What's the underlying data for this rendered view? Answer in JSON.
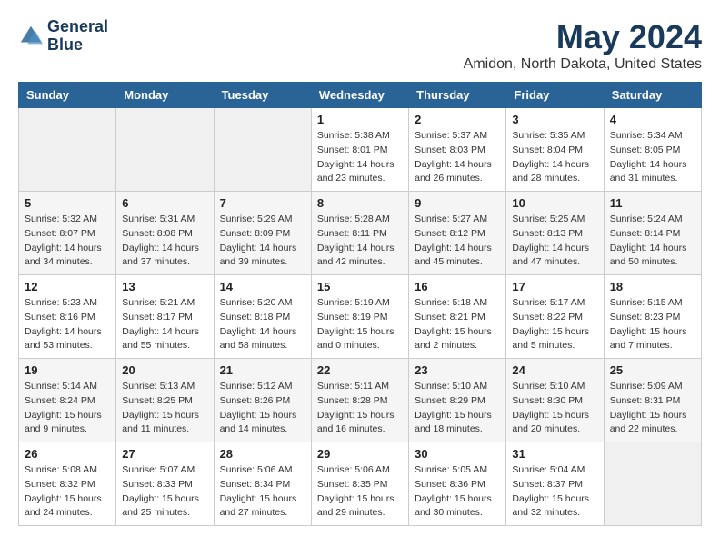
{
  "header": {
    "logo_line1": "General",
    "logo_line2": "Blue",
    "month_title": "May 2024",
    "location": "Amidon, North Dakota, United States"
  },
  "weekdays": [
    "Sunday",
    "Monday",
    "Tuesday",
    "Wednesday",
    "Thursday",
    "Friday",
    "Saturday"
  ],
  "weeks": [
    [
      {
        "day": "",
        "info": ""
      },
      {
        "day": "",
        "info": ""
      },
      {
        "day": "",
        "info": ""
      },
      {
        "day": "1",
        "info": "Sunrise: 5:38 AM\nSunset: 8:01 PM\nDaylight: 14 hours\nand 23 minutes."
      },
      {
        "day": "2",
        "info": "Sunrise: 5:37 AM\nSunset: 8:03 PM\nDaylight: 14 hours\nand 26 minutes."
      },
      {
        "day": "3",
        "info": "Sunrise: 5:35 AM\nSunset: 8:04 PM\nDaylight: 14 hours\nand 28 minutes."
      },
      {
        "day": "4",
        "info": "Sunrise: 5:34 AM\nSunset: 8:05 PM\nDaylight: 14 hours\nand 31 minutes."
      }
    ],
    [
      {
        "day": "5",
        "info": "Sunrise: 5:32 AM\nSunset: 8:07 PM\nDaylight: 14 hours\nand 34 minutes."
      },
      {
        "day": "6",
        "info": "Sunrise: 5:31 AM\nSunset: 8:08 PM\nDaylight: 14 hours\nand 37 minutes."
      },
      {
        "day": "7",
        "info": "Sunrise: 5:29 AM\nSunset: 8:09 PM\nDaylight: 14 hours\nand 39 minutes."
      },
      {
        "day": "8",
        "info": "Sunrise: 5:28 AM\nSunset: 8:11 PM\nDaylight: 14 hours\nand 42 minutes."
      },
      {
        "day": "9",
        "info": "Sunrise: 5:27 AM\nSunset: 8:12 PM\nDaylight: 14 hours\nand 45 minutes."
      },
      {
        "day": "10",
        "info": "Sunrise: 5:25 AM\nSunset: 8:13 PM\nDaylight: 14 hours\nand 47 minutes."
      },
      {
        "day": "11",
        "info": "Sunrise: 5:24 AM\nSunset: 8:14 PM\nDaylight: 14 hours\nand 50 minutes."
      }
    ],
    [
      {
        "day": "12",
        "info": "Sunrise: 5:23 AM\nSunset: 8:16 PM\nDaylight: 14 hours\nand 53 minutes."
      },
      {
        "day": "13",
        "info": "Sunrise: 5:21 AM\nSunset: 8:17 PM\nDaylight: 14 hours\nand 55 minutes."
      },
      {
        "day": "14",
        "info": "Sunrise: 5:20 AM\nSunset: 8:18 PM\nDaylight: 14 hours\nand 58 minutes."
      },
      {
        "day": "15",
        "info": "Sunrise: 5:19 AM\nSunset: 8:19 PM\nDaylight: 15 hours\nand 0 minutes."
      },
      {
        "day": "16",
        "info": "Sunrise: 5:18 AM\nSunset: 8:21 PM\nDaylight: 15 hours\nand 2 minutes."
      },
      {
        "day": "17",
        "info": "Sunrise: 5:17 AM\nSunset: 8:22 PM\nDaylight: 15 hours\nand 5 minutes."
      },
      {
        "day": "18",
        "info": "Sunrise: 5:15 AM\nSunset: 8:23 PM\nDaylight: 15 hours\nand 7 minutes."
      }
    ],
    [
      {
        "day": "19",
        "info": "Sunrise: 5:14 AM\nSunset: 8:24 PM\nDaylight: 15 hours\nand 9 minutes."
      },
      {
        "day": "20",
        "info": "Sunrise: 5:13 AM\nSunset: 8:25 PM\nDaylight: 15 hours\nand 11 minutes."
      },
      {
        "day": "21",
        "info": "Sunrise: 5:12 AM\nSunset: 8:26 PM\nDaylight: 15 hours\nand 14 minutes."
      },
      {
        "day": "22",
        "info": "Sunrise: 5:11 AM\nSunset: 8:28 PM\nDaylight: 15 hours\nand 16 minutes."
      },
      {
        "day": "23",
        "info": "Sunrise: 5:10 AM\nSunset: 8:29 PM\nDaylight: 15 hours\nand 18 minutes."
      },
      {
        "day": "24",
        "info": "Sunrise: 5:10 AM\nSunset: 8:30 PM\nDaylight: 15 hours\nand 20 minutes."
      },
      {
        "day": "25",
        "info": "Sunrise: 5:09 AM\nSunset: 8:31 PM\nDaylight: 15 hours\nand 22 minutes."
      }
    ],
    [
      {
        "day": "26",
        "info": "Sunrise: 5:08 AM\nSunset: 8:32 PM\nDaylight: 15 hours\nand 24 minutes."
      },
      {
        "day": "27",
        "info": "Sunrise: 5:07 AM\nSunset: 8:33 PM\nDaylight: 15 hours\nand 25 minutes."
      },
      {
        "day": "28",
        "info": "Sunrise: 5:06 AM\nSunset: 8:34 PM\nDaylight: 15 hours\nand 27 minutes."
      },
      {
        "day": "29",
        "info": "Sunrise: 5:06 AM\nSunset: 8:35 PM\nDaylight: 15 hours\nand 29 minutes."
      },
      {
        "day": "30",
        "info": "Sunrise: 5:05 AM\nSunset: 8:36 PM\nDaylight: 15 hours\nand 30 minutes."
      },
      {
        "day": "31",
        "info": "Sunrise: 5:04 AM\nSunset: 8:37 PM\nDaylight: 15 hours\nand 32 minutes."
      },
      {
        "day": "",
        "info": ""
      }
    ]
  ]
}
